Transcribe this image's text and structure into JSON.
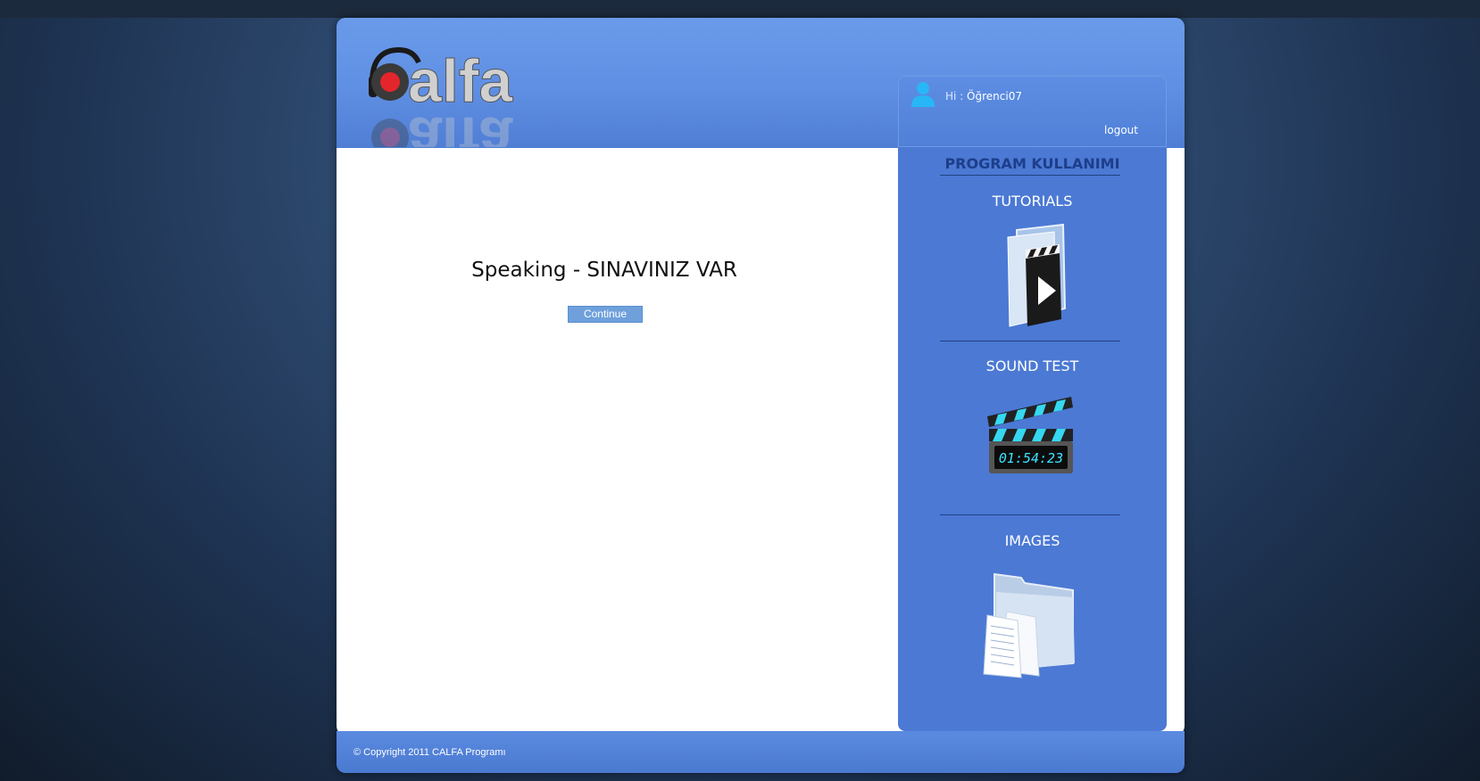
{
  "brand": {
    "logo_text": "calfa"
  },
  "user": {
    "greeting_prefix": "Hi :",
    "name": "Öğrenci07",
    "logout_label": "logout"
  },
  "main": {
    "title": "Speaking - SINAVINIZ VAR",
    "continue_label": "Continue"
  },
  "sidebar": {
    "title": "PROGRAM KULLANIMI",
    "sections": [
      {
        "label": "TUTORIALS",
        "icon": "tutorial-video-icon"
      },
      {
        "label": "SOUND TEST",
        "icon": "clapperboard-icon",
        "display_value": "01:54:23"
      },
      {
        "label": "IMAGES",
        "icon": "images-folder-icon"
      }
    ]
  },
  "footer": {
    "copyright": "© Copyright 2011 CALFA Programı"
  },
  "colors": {
    "header_blue": "#5f8fe3",
    "sidebar_blue": "#4b79d4",
    "button_blue": "#6fa0dc",
    "sidebar_title": "#1d3e8a"
  }
}
